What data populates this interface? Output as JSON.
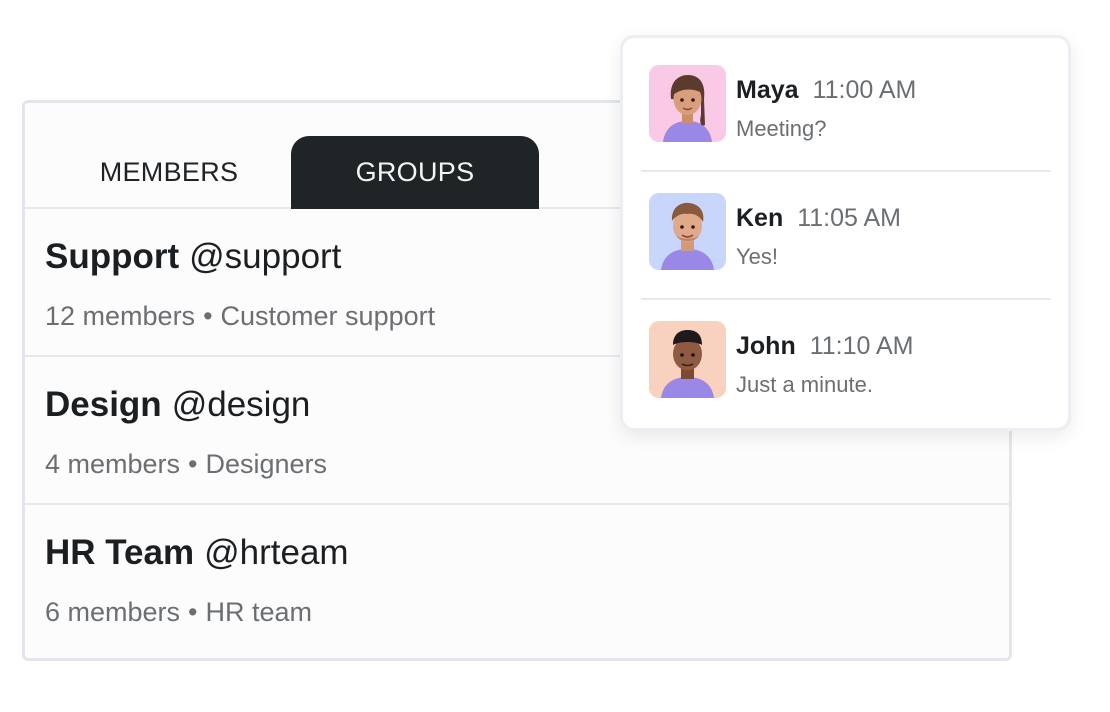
{
  "tabs": {
    "members_label": "MEMBERS",
    "groups_label": "GROUPS",
    "active": "GROUPS"
  },
  "groups": [
    {
      "name": "Support",
      "handle": "@support",
      "members": "12 members",
      "separator": "•",
      "description": "Customer support"
    },
    {
      "name": "Design",
      "handle": "@design",
      "members": "4 members",
      "separator": "•",
      "description": "Designers"
    },
    {
      "name": "HR Team",
      "handle": "@hrteam",
      "members": "6 members",
      "separator": "•",
      "description": "HR team"
    }
  ],
  "messages": [
    {
      "name": "Maya",
      "time": "11:00 AM",
      "text": "Meeting?",
      "avatar_icon": "avatar-woman-icon",
      "avatar_bg": "#f9c9e6"
    },
    {
      "name": "Ken",
      "time": "11:05 AM",
      "text": "Yes!",
      "avatar_icon": "avatar-man-icon",
      "avatar_bg": "#c9d6fb"
    },
    {
      "name": "John",
      "time": "11:10 AM",
      "text": "Just a minute.",
      "avatar_icon": "avatar-man-icon",
      "avatar_bg": "#f9d2bf"
    }
  ],
  "colors": {
    "active_tab_bg": "#1f2426",
    "shirt_purple": "#9b87e6"
  }
}
